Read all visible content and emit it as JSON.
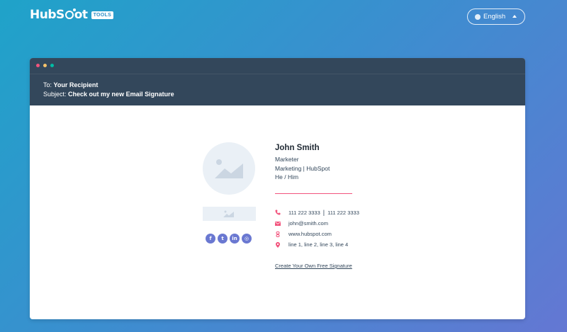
{
  "header": {
    "logo_text_before": "HubS",
    "logo_text_after": "ot",
    "tools_badge": "TOOLS",
    "language": "English"
  },
  "email": {
    "to_label": "To:",
    "to_value": "Your Recipient",
    "subject_label": "Subject:",
    "subject_value": "Check out my new Email Signature"
  },
  "signature": {
    "name": "John Smith",
    "title": "Marketer",
    "department_company": "Marketing | HubSpot",
    "pronouns": "He / Him",
    "phone": "111 222 3333",
    "mobile": "111 222 3333",
    "phone_separator": "|",
    "email": "john@smith.com",
    "website": "www.hubspot.com",
    "address": "line 1, line 2, line 3, line 4",
    "cta": "Create Your Own Free Signature",
    "social": [
      {
        "icon": "facebook-icon",
        "glyph": "f"
      },
      {
        "icon": "twitter-icon",
        "glyph": "t"
      },
      {
        "icon": "linkedin-icon",
        "glyph": "in"
      },
      {
        "icon": "instagram-icon",
        "glyph": "◎"
      }
    ]
  },
  "colors": {
    "header_bg": "#33475b",
    "accent_pink": "#f2547d",
    "social_blue": "#6a78d1",
    "dot_red": "#f2547d",
    "dot_yellow": "#f5c26b",
    "dot_green": "#00bda5"
  }
}
